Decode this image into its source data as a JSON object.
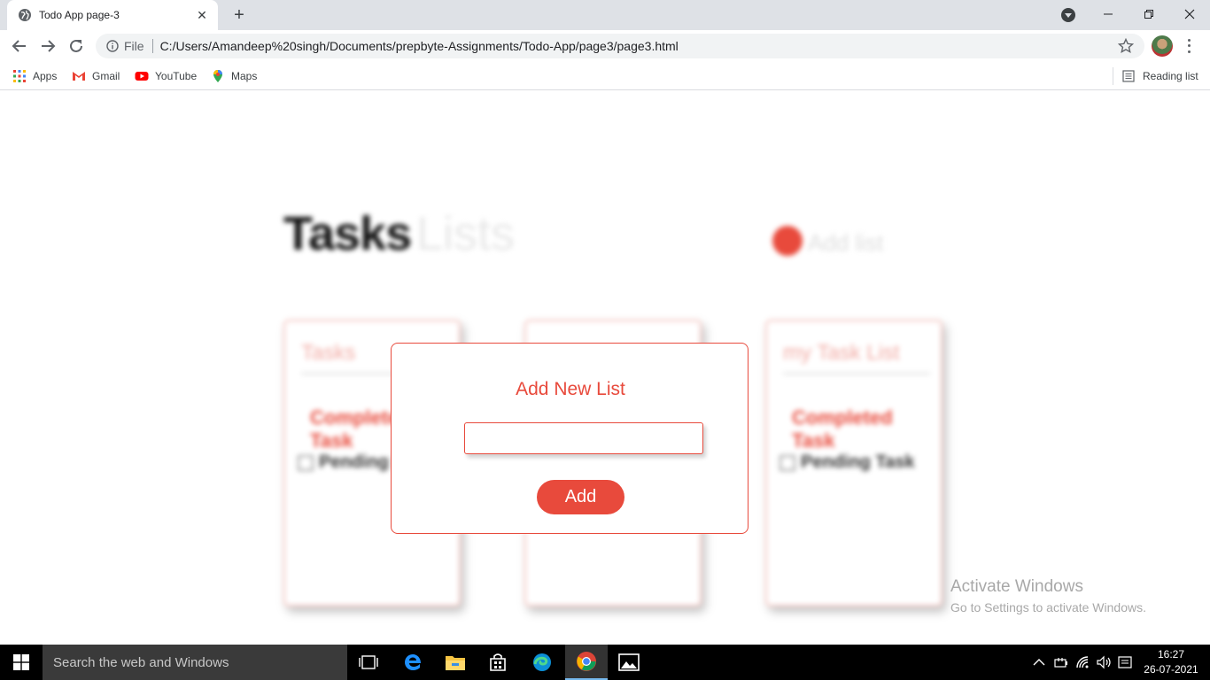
{
  "browser": {
    "tab_title": "Todo App page-3",
    "url_scheme_label": "File",
    "url": "C:/Users/Amandeep%20singh/Documents/prepbyte-Assignments/Todo-App/page3/page3.html",
    "bookmarks": [
      {
        "label": "Apps",
        "icon": "apps-grid-icon"
      },
      {
        "label": "Gmail",
        "icon": "gmail-icon"
      },
      {
        "label": "YouTube",
        "icon": "youtube-icon"
      },
      {
        "label": "Maps",
        "icon": "maps-icon"
      }
    ],
    "reading_list": "Reading list"
  },
  "app": {
    "header_tasks": "Tasks",
    "header_lists": "Lists",
    "add_list_label": "Add list",
    "cards": [
      {
        "title": "Tasks",
        "completed": "Completed Task",
        "pending": "Pending Task"
      },
      {
        "title": "",
        "completed": "",
        "pending": ""
      },
      {
        "title": "my Task List",
        "completed": "Completed Task",
        "pending": "Pending Task"
      }
    ],
    "accent_color": "#e84a3c"
  },
  "modal": {
    "title": "Add New List",
    "input_value": "",
    "add_button": "Add"
  },
  "watermark": {
    "line1": "Activate Windows",
    "line2": "Go to Settings to activate Windows."
  },
  "taskbar": {
    "search_placeholder": "Search the web and Windows",
    "time": "16:27",
    "date": "26-07-2021"
  }
}
